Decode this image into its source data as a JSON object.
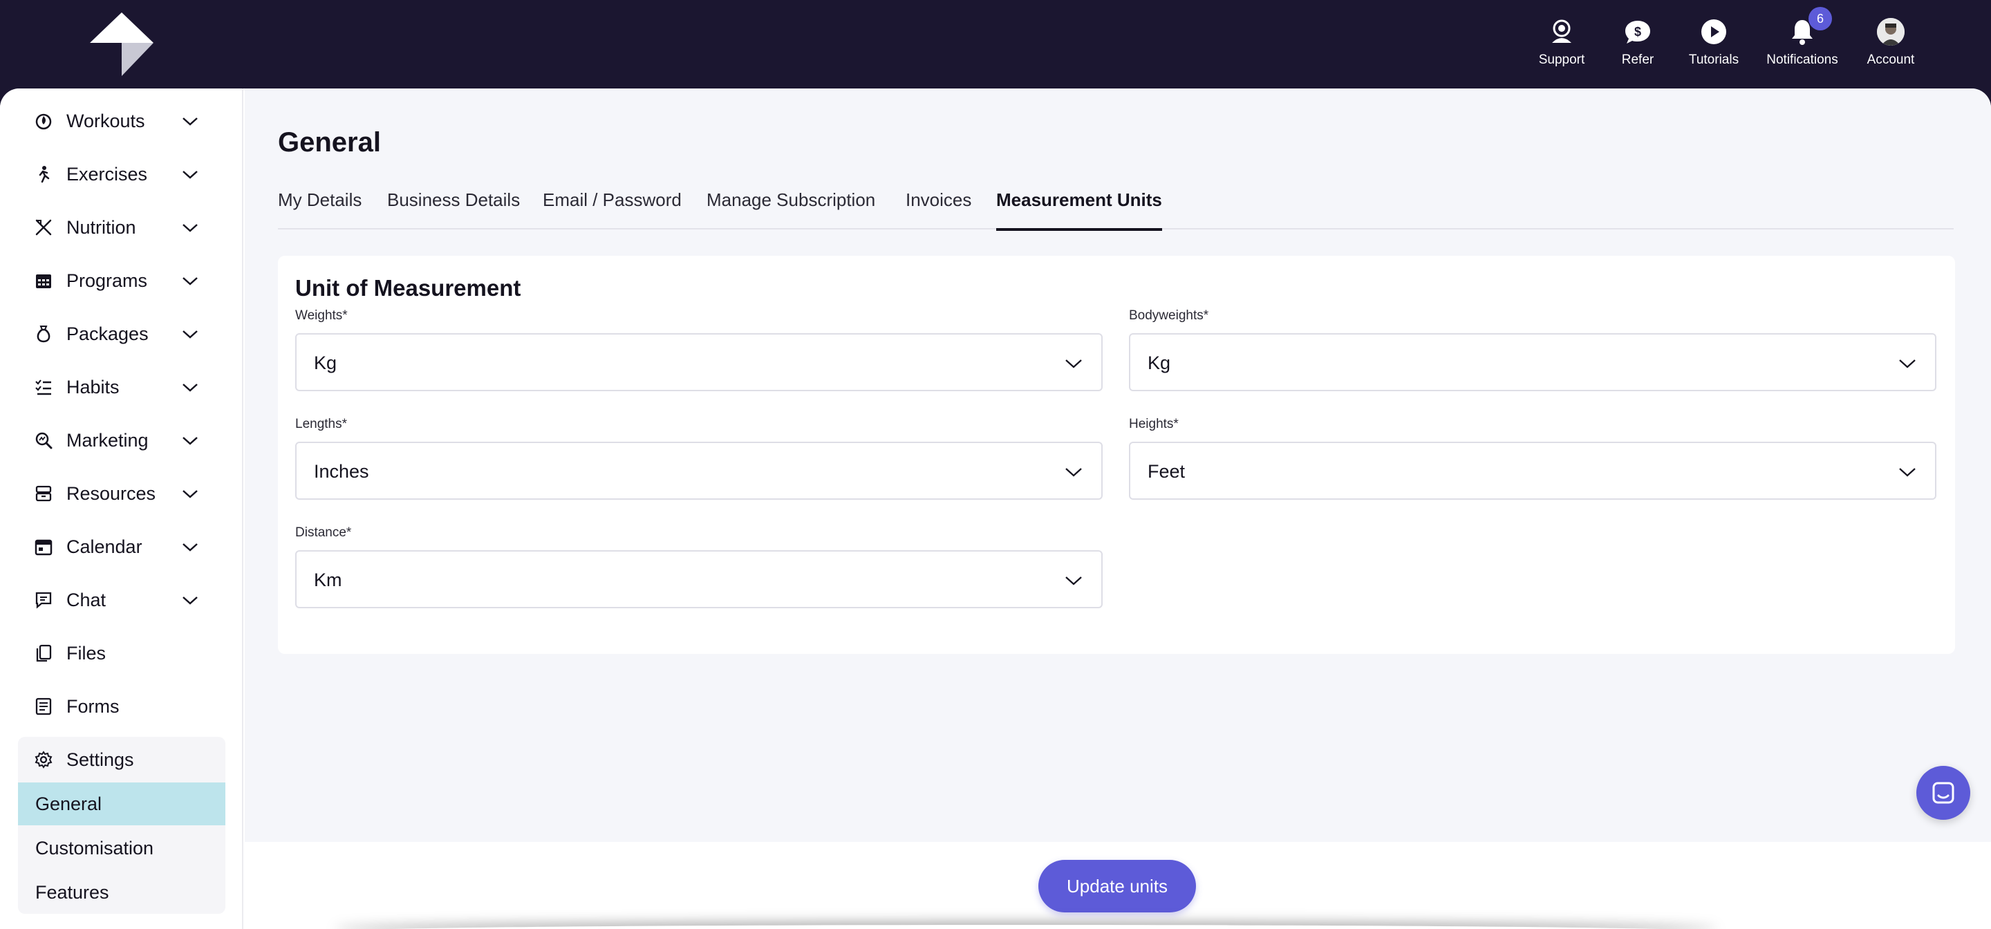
{
  "topbar": {
    "items": [
      {
        "label": "Support",
        "icon": "support-headset-icon"
      },
      {
        "label": "Refer",
        "icon": "refer-dollar-chat-icon"
      },
      {
        "label": "Tutorials",
        "icon": "play-circle-icon"
      },
      {
        "label": "Notifications",
        "icon": "bell-icon",
        "badge": "6"
      },
      {
        "label": "Account",
        "icon": "avatar"
      }
    ]
  },
  "sidebar": {
    "items": [
      {
        "label": "Workouts",
        "icon": "workouts-icon"
      },
      {
        "label": "Exercises",
        "icon": "running-person-icon"
      },
      {
        "label": "Nutrition",
        "icon": "utensils-icon"
      },
      {
        "label": "Programs",
        "icon": "calendar-grid-icon"
      },
      {
        "label": "Packages",
        "icon": "money-bag-icon"
      },
      {
        "label": "Habits",
        "icon": "checklist-icon"
      },
      {
        "label": "Marketing",
        "icon": "magnifier-icon"
      },
      {
        "label": "Resources",
        "icon": "archive-icon"
      },
      {
        "label": "Calendar",
        "icon": "calendar-icon"
      },
      {
        "label": "Chat",
        "icon": "chat-icon"
      },
      {
        "label": "Files",
        "icon": "files-icon"
      },
      {
        "label": "Forms",
        "icon": "forms-icon"
      }
    ],
    "settings": {
      "label": "Settings",
      "icon": "gear-icon",
      "sub_items": [
        {
          "label": "General",
          "active": true
        },
        {
          "label": "Customisation",
          "active": false
        },
        {
          "label": "Features",
          "active": false
        }
      ]
    }
  },
  "main": {
    "title": "General",
    "tabs": [
      {
        "label": "My Details",
        "active": false
      },
      {
        "label": "Business Details",
        "active": false
      },
      {
        "label": "Email / Password",
        "active": false
      },
      {
        "label": "Manage Subscription",
        "active": false
      },
      {
        "label": "Invoices",
        "active": false
      },
      {
        "label": "Measurement Units",
        "active": true
      }
    ],
    "card": {
      "title": "Unit of Measurement",
      "fields": {
        "weights": {
          "label": "Weights*",
          "value": "Kg"
        },
        "bodyweights": {
          "label": "Bodyweights*",
          "value": "Kg"
        },
        "lengths": {
          "label": "Lengths*",
          "value": "Inches"
        },
        "heights": {
          "label": "Heights*",
          "value": "Feet"
        },
        "distance": {
          "label": "Distance*",
          "value": "Km"
        }
      }
    }
  },
  "footer": {
    "update_button": "Update units"
  },
  "colors": {
    "topbar_bg": "#1b1630",
    "accent": "#5d5bd8",
    "active_subitem_bg": "#bde4ec",
    "main_bg": "#f5f6fa"
  }
}
